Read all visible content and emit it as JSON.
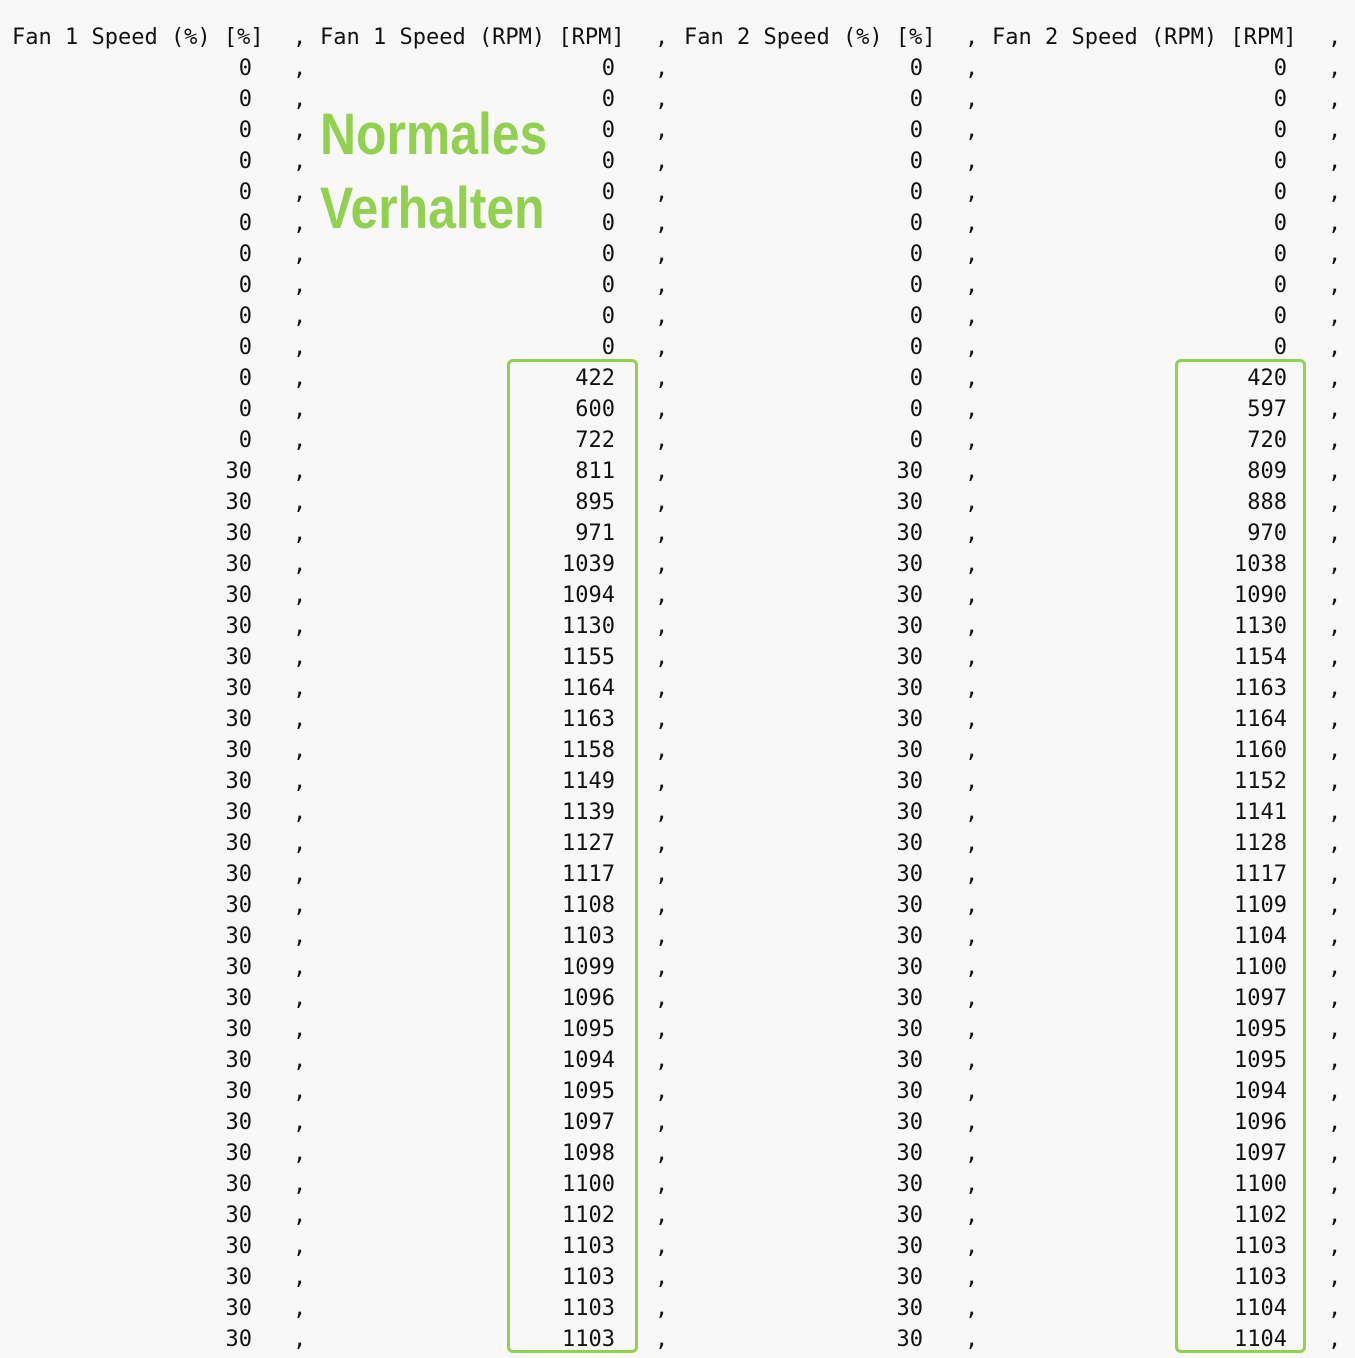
{
  "table": {
    "separator": ",",
    "headers": [
      "Fan 1 Speed (%) [%]",
      "Fan 1 Speed (RPM) [RPM]",
      "Fan 2 Speed (%) [%]",
      "Fan 2 Speed (RPM) [RPM]"
    ],
    "rows": [
      [
        "0",
        "0",
        "0",
        "0"
      ],
      [
        "0",
        "0",
        "0",
        "0"
      ],
      [
        "0",
        "0",
        "0",
        "0"
      ],
      [
        "0",
        "0",
        "0",
        "0"
      ],
      [
        "0",
        "0",
        "0",
        "0"
      ],
      [
        "0",
        "0",
        "0",
        "0"
      ],
      [
        "0",
        "0",
        "0",
        "0"
      ],
      [
        "0",
        "0",
        "0",
        "0"
      ],
      [
        "0",
        "0",
        "0",
        "0"
      ],
      [
        "0",
        "0",
        "0",
        "0"
      ],
      [
        "0",
        "422",
        "0",
        "420"
      ],
      [
        "0",
        "600",
        "0",
        "597"
      ],
      [
        "0",
        "722",
        "0",
        "720"
      ],
      [
        "30",
        "811",
        "30",
        "809"
      ],
      [
        "30",
        "895",
        "30",
        "888"
      ],
      [
        "30",
        "971",
        "30",
        "970"
      ],
      [
        "30",
        "1039",
        "30",
        "1038"
      ],
      [
        "30",
        "1094",
        "30",
        "1090"
      ],
      [
        "30",
        "1130",
        "30",
        "1130"
      ],
      [
        "30",
        "1155",
        "30",
        "1154"
      ],
      [
        "30",
        "1164",
        "30",
        "1163"
      ],
      [
        "30",
        "1163",
        "30",
        "1164"
      ],
      [
        "30",
        "1158",
        "30",
        "1160"
      ],
      [
        "30",
        "1149",
        "30",
        "1152"
      ],
      [
        "30",
        "1139",
        "30",
        "1141"
      ],
      [
        "30",
        "1127",
        "30",
        "1128"
      ],
      [
        "30",
        "1117",
        "30",
        "1117"
      ],
      [
        "30",
        "1108",
        "30",
        "1109"
      ],
      [
        "30",
        "1103",
        "30",
        "1104"
      ],
      [
        "30",
        "1099",
        "30",
        "1100"
      ],
      [
        "30",
        "1096",
        "30",
        "1097"
      ],
      [
        "30",
        "1095",
        "30",
        "1095"
      ],
      [
        "30",
        "1094",
        "30",
        "1095"
      ],
      [
        "30",
        "1095",
        "30",
        "1094"
      ],
      [
        "30",
        "1097",
        "30",
        "1096"
      ],
      [
        "30",
        "1098",
        "30",
        "1097"
      ],
      [
        "30",
        "1100",
        "30",
        "1100"
      ],
      [
        "30",
        "1102",
        "30",
        "1102"
      ],
      [
        "30",
        "1103",
        "30",
        "1103"
      ],
      [
        "30",
        "1103",
        "30",
        "1103"
      ],
      [
        "30",
        "1103",
        "30",
        "1104"
      ],
      [
        "30",
        "1103",
        "30",
        "1104"
      ]
    ]
  },
  "annotation": {
    "line1": "Normales",
    "line2": "Verhalten",
    "color": "#92d050"
  }
}
